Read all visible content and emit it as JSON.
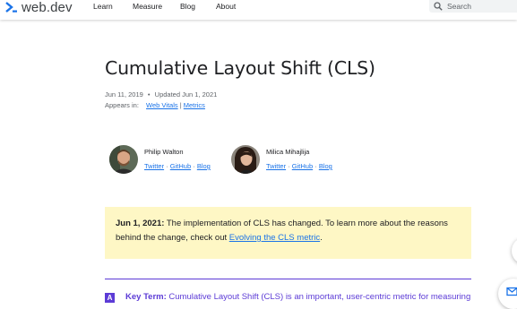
{
  "header": {
    "logo_text": "web.dev",
    "nav": [
      "Learn",
      "Measure",
      "Blog",
      "About"
    ],
    "search_placeholder": "Search"
  },
  "article": {
    "title": "Cumulative Layout Shift (CLS)",
    "published": "Jun 11, 2019",
    "meta_separator": "•",
    "updated": "Updated Jun 1, 2021",
    "appears_in_label": "Appears in:",
    "appears_in": [
      "Web Vitals",
      "Metrics"
    ],
    "appears_in_separator": "|"
  },
  "authors": [
    {
      "name": "Philip Walton",
      "links": [
        "Twitter",
        "GitHub",
        "Blog"
      ]
    },
    {
      "name": "Milica Mihajlija",
      "links": [
        "Twitter",
        "GitHub",
        "Blog"
      ]
    }
  ],
  "link_separator": "·",
  "callout": {
    "date": "Jun 1, 2021:",
    "text": " The implementation of CLS has changed. To learn more about the reasons behind the change, check out ",
    "link": "Evolving the CLS metric",
    "end": "."
  },
  "key_term": {
    "badge": "A",
    "label": "Key Term:",
    "text": " Cumulative Layout Shift (CLS) is an important, user-centric metric for measuring"
  },
  "colors": {
    "accent": "#5c3bd6",
    "link": "#1a73e8",
    "callout_bg": "#fef7c5",
    "logo_blue": "#1a73e8"
  }
}
